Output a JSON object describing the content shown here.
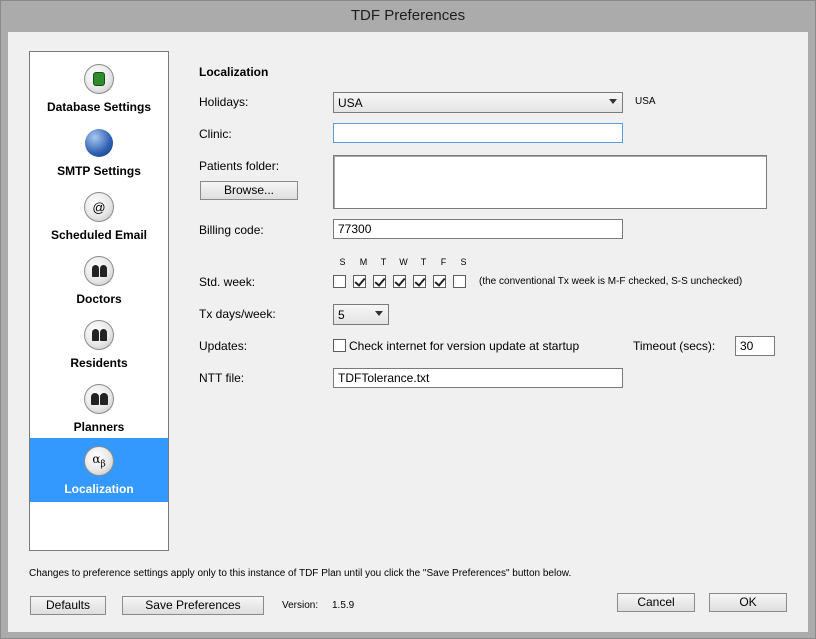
{
  "window": {
    "title": "TDF Preferences"
  },
  "sidebar": {
    "items": [
      {
        "label": "Database Settings",
        "icon": "database-icon"
      },
      {
        "label": "SMTP Settings",
        "icon": "globe-icon"
      },
      {
        "label": "Scheduled Email",
        "icon": "at-sign-icon"
      },
      {
        "label": "Doctors",
        "icon": "people-icon"
      },
      {
        "label": "Residents",
        "icon": "people-icon"
      },
      {
        "label": "Planners",
        "icon": "people-icon"
      },
      {
        "label": "Localization",
        "icon": "alpha-beta-icon",
        "selected": true
      }
    ]
  },
  "localization": {
    "heading": "Localization",
    "holidays_label": "Holidays:",
    "holidays_value": "USA",
    "holidays_note": "USA",
    "clinic_label": "Clinic:",
    "clinic_value": "",
    "patients_folder_label": "Patients folder:",
    "browse_label": "Browse...",
    "patients_folder_value": "",
    "billing_code_label": "Billing code:",
    "billing_code_value": "77300",
    "std_week_label": "Std. week:",
    "days": [
      "S",
      "M",
      "T",
      "W",
      "T",
      "F",
      "S"
    ],
    "days_checked": [
      false,
      true,
      true,
      true,
      true,
      true,
      false
    ],
    "std_week_note": "(the conventional Tx week is M-F checked, S-S unchecked)",
    "tx_days_label": "Tx days/week:",
    "tx_days_value": "5",
    "updates_label": "Updates:",
    "updates_checkbox_label": "Check internet for version update at startup",
    "updates_checked": false,
    "timeout_label": "Timeout (secs):",
    "timeout_value": "30",
    "ntt_label": "NTT file:",
    "ntt_value": "TDFTolerance.txt"
  },
  "footer": {
    "notice": "Changes to preference settings apply only to this instance of TDF Plan until you click the \"Save Preferences\" button below.",
    "defaults_label": "Defaults",
    "save_label": "Save Preferences",
    "version_label": "Version:",
    "version_value": "1.5.9",
    "cancel_label": "Cancel",
    "ok_label": "OK"
  },
  "colors": {
    "selected_bg": "#3399ff",
    "title_bg": "#ababab",
    "client_bg": "#f0f0f0"
  }
}
